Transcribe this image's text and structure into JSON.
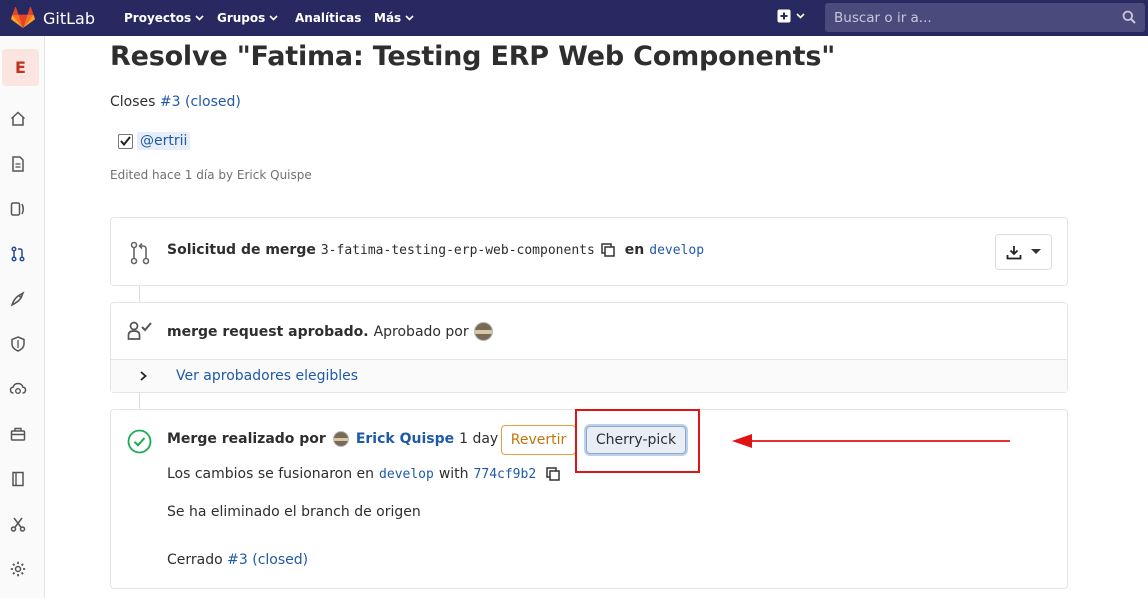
{
  "navbar": {
    "brand": "GitLab",
    "projects": "Proyectos",
    "groups": "Grupos",
    "analytics": "Analíticas",
    "more": "Más",
    "search_placeholder": "Buscar o ir a..."
  },
  "sidebar": {
    "project_initial": "E",
    "items": [
      "home-icon",
      "repository-icon",
      "issues-icon",
      "merge-requests-icon",
      "ci-cd-icon",
      "security-icon",
      "operations-icon",
      "packages-icon",
      "wiki-icon",
      "snippets-icon",
      "settings-icon"
    ]
  },
  "mr": {
    "title": "Resolve \"Fatima: Testing ERP Web Components\"",
    "closes_prefix": "Closes",
    "closes_link": "#3 (closed)",
    "task_mention": "@ertrii",
    "task_checked": true,
    "edited": "Edited hace 1 día by Erick Quispe"
  },
  "widget": {
    "request_label": "Solicitud de merge",
    "source_branch": "3-fatima-testing-erp-web-components",
    "en": "en",
    "target_branch": "develop",
    "approval_strong": "merge request aprobado.",
    "approval_text": "Aprobado por",
    "view_approvers": "Ver aprobadores elegibles",
    "merged_by_label": "Merge realizado por",
    "merged_by_user": "Erick Quispe",
    "merged_time": "1 day ago",
    "revert_label": "Revertir",
    "cherry_pick_label": "Cherry-pick",
    "merged_into_text": "Los cambios se fusionaron en",
    "merged_into_branch": "develop",
    "with": "with",
    "commit_sha": "774cf9b2",
    "source_deleted": "Se ha eliminado el branch de origen",
    "closed_prefix": "Cerrado",
    "closed_link": "#3 (closed)"
  },
  "colors": {
    "navbar": "#292961",
    "link": "#1f5aa8",
    "success": "#1aaa55",
    "warning": "#e4a03f",
    "annotation": "#e01414"
  }
}
